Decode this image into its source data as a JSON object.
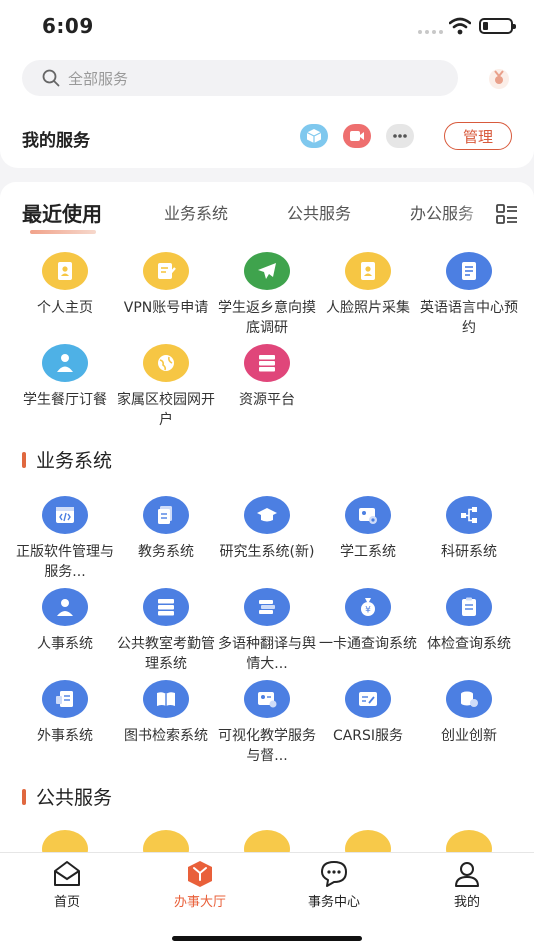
{
  "status": {
    "time": "6:09"
  },
  "search": {
    "placeholder": "全部服务"
  },
  "my_services": {
    "title": "我的服务",
    "manage_label": "管理"
  },
  "tabs": [
    {
      "label": "最近使用"
    },
    {
      "label": "业务系统"
    },
    {
      "label": "公共服务"
    },
    {
      "label": "办公服务"
    }
  ],
  "recent": [
    {
      "label": "个人主页",
      "icon": "id-card-icon",
      "color": "#f6c644"
    },
    {
      "label": "VPN账号申请",
      "icon": "edit-doc-icon",
      "color": "#f6c644"
    },
    {
      "label": "学生返乡意向摸底调研",
      "icon": "plane-icon",
      "color": "#3fa34d"
    },
    {
      "label": "人脸照片采集",
      "icon": "id-card-icon",
      "color": "#f6c644"
    },
    {
      "label": "英语语言中心预约",
      "icon": "form-icon",
      "color": "#4c7fe2"
    },
    {
      "label": "学生餐厅订餐",
      "icon": "chef-icon",
      "color": "#4eb1e6"
    },
    {
      "label": "家属区校园网开户",
      "icon": "globe-icon",
      "color": "#f6c644"
    },
    {
      "label": "资源平台",
      "icon": "server-icon",
      "color": "#e0467a"
    }
  ],
  "business": {
    "title": "业务系统",
    "items": [
      {
        "label": "正版软件管理与服务...",
        "icon": "code-window-icon",
        "color": "#4c7fe2"
      },
      {
        "label": "教务系统",
        "icon": "documents-icon",
        "color": "#4c7fe2"
      },
      {
        "label": "研究生系统(新)",
        "icon": "graduation-cap-icon",
        "color": "#4c7fe2"
      },
      {
        "label": "学工系统",
        "icon": "id-settings-icon",
        "color": "#4c7fe2"
      },
      {
        "label": "科研系统",
        "icon": "network-icon",
        "color": "#4c7fe2"
      },
      {
        "label": "人事系统",
        "icon": "person-icon",
        "color": "#4c7fe2"
      },
      {
        "label": "公共教室考勤管理系统",
        "icon": "server-icon",
        "color": "#4c7fe2"
      },
      {
        "label": "多语种翻译与舆情大...",
        "icon": "books-icon",
        "color": "#4c7fe2"
      },
      {
        "label": "一卡通查询系统",
        "icon": "money-bag-icon",
        "color": "#4c7fe2"
      },
      {
        "label": "体检查询系统",
        "icon": "clipboard-icon",
        "color": "#4c7fe2"
      },
      {
        "label": "外事系统",
        "icon": "foreign-doc-icon",
        "color": "#4c7fe2"
      },
      {
        "label": "图书检索系统",
        "icon": "open-book-icon",
        "color": "#4c7fe2"
      },
      {
        "label": "可视化教学服务与督...",
        "icon": "id-card-badge-icon",
        "color": "#4c7fe2"
      },
      {
        "label": "CARSI服务",
        "icon": "card-edit-icon",
        "color": "#4c7fe2"
      },
      {
        "label": "创业创新",
        "icon": "coins-icon",
        "color": "#4c7fe2"
      }
    ]
  },
  "public": {
    "title": "公共服务"
  },
  "bottom_nav": [
    {
      "label": "首页",
      "icon": "home-mail-icon"
    },
    {
      "label": "办事大厅",
      "icon": "cube-box-icon"
    },
    {
      "label": "事务中心",
      "icon": "chat-bubble-icon"
    },
    {
      "label": "我的",
      "icon": "user-icon"
    }
  ],
  "colors": {
    "accent": "#e9603a",
    "blue": "#4c7fe2",
    "yellow": "#f6c644"
  }
}
